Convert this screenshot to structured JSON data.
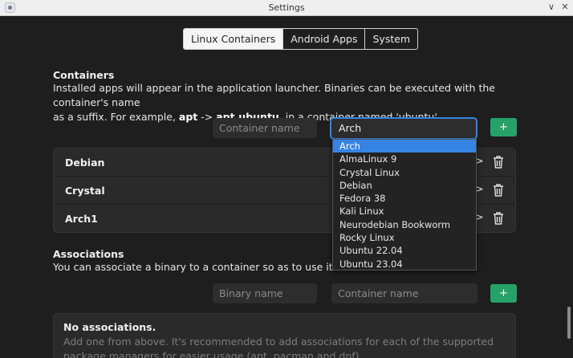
{
  "window": {
    "title": "Settings",
    "minimize_glyph": "∨",
    "close_glyph": "✕"
  },
  "tabs": [
    {
      "label": "Linux Containers",
      "active": true
    },
    {
      "label": "Android Apps",
      "active": false
    },
    {
      "label": "System",
      "active": false
    }
  ],
  "containers": {
    "title": "Containers",
    "desc_line1": "Installed apps will appear in the application launcher. Binaries can be executed with the container's name",
    "desc_line2_prefix": "as a suffix. For example, ",
    "example_bin": "apt",
    "arrow": " -> ",
    "example_full": "apt.ubuntu",
    "desc_line2_suffix": ", in a container named 'ubuntu'.",
    "name_placeholder": "Container name",
    "distro_selected": "Arch",
    "add_label": "+",
    "rows": [
      {
        "name": "Debian"
      },
      {
        "name": "Crystal"
      },
      {
        "name": "Arch1"
      }
    ],
    "row_chevron": ">"
  },
  "dropdown": {
    "options": [
      "Arch",
      "AlmaLinux 9",
      "Crystal Linux",
      "Debian",
      "Fedora 38",
      "Kali Linux",
      "Neurodebian Bookworm",
      "Rocky Linux",
      "Ubuntu 22.04",
      "Ubuntu 23.04"
    ],
    "highlighted_index": 0
  },
  "associations": {
    "title": "Associations",
    "desc": "You can associate a binary to a container so as to use it without a",
    "binary_placeholder": "Binary name",
    "container_placeholder": "Container name",
    "add_label": "+",
    "empty_title": "No associations.",
    "empty_body": "Add one from above. It's recommended to add associations for each of the supported package managers for easier usage (apt, pacman and dnf)."
  },
  "colors": {
    "accent": "#3584e4",
    "add_button": "#26a269",
    "background": "#1e1e1e"
  }
}
